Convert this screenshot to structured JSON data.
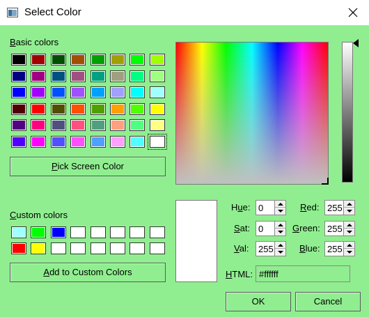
{
  "window": {
    "title": "Select Color",
    "icon": "app-window-icon",
    "close_icon": "close-icon"
  },
  "basic_colors": {
    "label_key": "B",
    "label_rest": "asic colors",
    "swatches": [
      [
        "#000000",
        "#a00000",
        "#005000",
        "#a05000",
        "#00a000",
        "#a0a000",
        "#00ff00",
        "#a0ff00"
      ],
      [
        "#000080",
        "#a00080",
        "#005080",
        "#a05080",
        "#00a080",
        "#a0a080",
        "#00ff80",
        "#a0ff80"
      ],
      [
        "#0000ff",
        "#a000ff",
        "#0050ff",
        "#a050ff",
        "#00a0ff",
        "#a0a0ff",
        "#00ffff",
        "#a0ffff"
      ],
      [
        "#500000",
        "#ff0000",
        "#505000",
        "#ff5000",
        "#50a000",
        "#ffa000",
        "#50ff00",
        "#ffff00"
      ],
      [
        "#500080",
        "#ff0080",
        "#505080",
        "#ff5080",
        "#50a080",
        "#ffa080",
        "#50ff80",
        "#ffff80"
      ],
      [
        "#5000ff",
        "#ff00ff",
        "#5050ff",
        "#ff50ff",
        "#50a0ff",
        "#ffa0ff",
        "#50ffff",
        "#ffffff"
      ]
    ],
    "selected": [
      5,
      7
    ]
  },
  "pick_screen_button": {
    "key": "P",
    "rest": "ick Screen Color"
  },
  "custom_colors": {
    "label_key": "C",
    "label_rest": "ustom colors",
    "swatches": [
      [
        "#a0ffff",
        "#00ff00",
        "#0000ff",
        "#ffffff",
        "#ffffff",
        "#ffffff",
        "#ffffff",
        "#ffffff"
      ],
      [
        "#ff0000",
        "#ffff00",
        "#ffffff",
        "#ffffff",
        "#ffffff",
        "#ffffff",
        "#ffffff",
        "#ffffff"
      ]
    ]
  },
  "add_custom_button": {
    "key": "A",
    "rest": "dd to Custom Colors"
  },
  "preview_color": "#ffffff",
  "fields": {
    "hue": {
      "key": "u",
      "pre": "H",
      "post": "e:",
      "value": "0"
    },
    "sat": {
      "key": "S",
      "pre": "",
      "post": "at:",
      "value": "0"
    },
    "val": {
      "key": "V",
      "pre": "",
      "post": "al:",
      "value": "255"
    },
    "red": {
      "key": "R",
      "pre": "",
      "post": "ed:",
      "value": "255"
    },
    "green": {
      "key": "G",
      "pre": "",
      "post": "reen:",
      "value": "255"
    },
    "blue": {
      "key": "B",
      "pre": "",
      "post": "lue:",
      "value": "255"
    },
    "html": {
      "key": "H",
      "pre": "",
      "post": "TML:",
      "value": "#ffffff"
    }
  },
  "buttons": {
    "ok": "OK",
    "cancel": "Cancel"
  },
  "colors": {
    "background": "#90ee90",
    "titlebar": "#ffffff"
  }
}
